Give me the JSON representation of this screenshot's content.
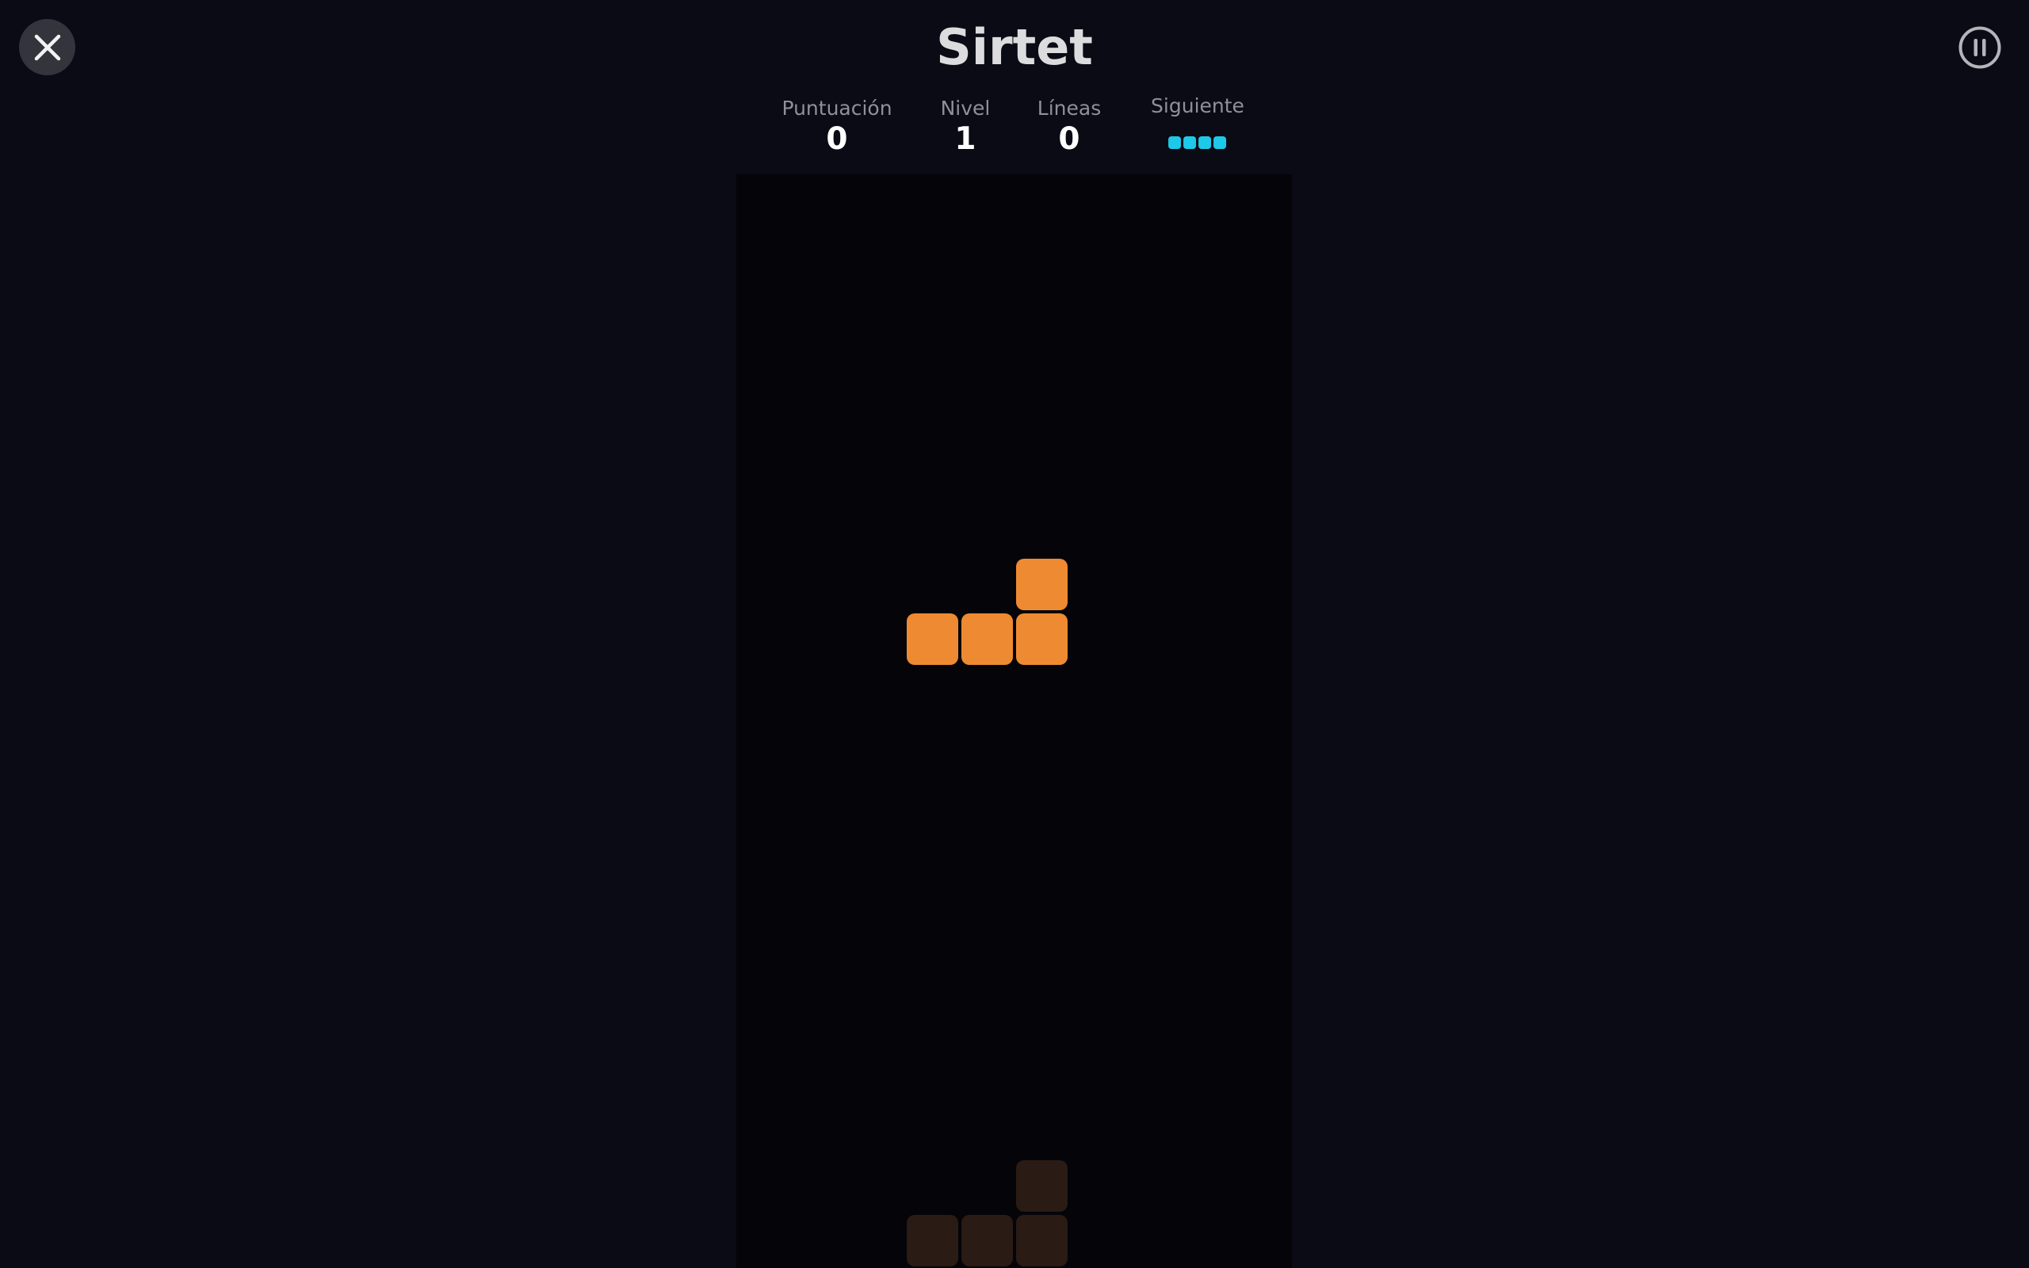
{
  "header": {
    "title": "Sirtet",
    "close_icon": "close-icon",
    "pause_icon": "pause-icon"
  },
  "stats": {
    "score_label": "Puntuación",
    "score_value": "0",
    "level_label": "Nivel",
    "level_value": "1",
    "lines_label": "Líneas",
    "lines_value": "0",
    "next_label": "Siguiente",
    "next_piece": "I",
    "next_color": "#1ec8e8"
  },
  "board": {
    "columns": 10,
    "active_piece": {
      "type": "L",
      "color": "#ee8a31",
      "cells": [
        [
          5,
          7
        ],
        [
          3,
          8
        ],
        [
          4,
          8
        ],
        [
          5,
          8
        ]
      ]
    },
    "ghost_piece": {
      "color": "#2a1b15",
      "cells": [
        [
          5,
          18
        ],
        [
          3,
          19
        ],
        [
          4,
          19
        ],
        [
          5,
          19
        ]
      ]
    }
  }
}
